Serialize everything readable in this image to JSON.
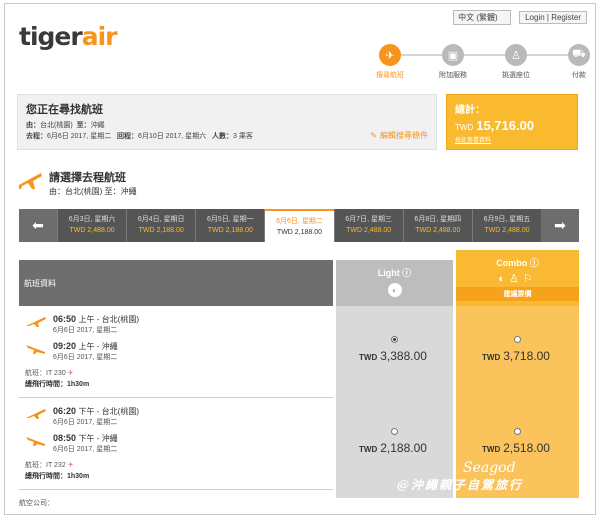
{
  "header": {
    "logo_prefix": "tiger",
    "logo_suffix": "air",
    "language": "中文 (繁體)",
    "login": "Login | Register"
  },
  "steps": [
    {
      "label": "搜尋航班",
      "icon": "plane-icon"
    },
    {
      "label": "附加服務",
      "icon": "bag-icon"
    },
    {
      "label": "挑選座位",
      "icon": "seat-icon"
    },
    {
      "label": "付款",
      "icon": "cart-icon"
    }
  ],
  "search": {
    "title": "您正在尋找航班",
    "from_label": "由：",
    "from": "台北(桃園)",
    "to_label": "至：",
    "to": "沖繩",
    "depart_label": "去程：",
    "depart": "6月6日 2017, 星期二",
    "return_label": "回程：",
    "return": "6月10日 2017, 星期六",
    "pax_label": "人數：",
    "pax": "3 乘客",
    "edit_link": "編輯搜尋條件"
  },
  "total": {
    "label": "總計：",
    "currency": "TWD",
    "amount": "15,716.00",
    "detail_link": "按此查看資料"
  },
  "outbound": {
    "title": "請選擇去程航班",
    "route": "由：台北(桃園) 至：沖繩"
  },
  "dates": [
    {
      "label": "6月3日, 星期六",
      "price": "TWD 2,488.00"
    },
    {
      "label": "6月4日, 星期日",
      "price": "TWD 2,188.00"
    },
    {
      "label": "6月5日, 星期一",
      "price": "TWD 2,188.00"
    },
    {
      "label": "6月6日, 星期二",
      "price": "TWD 2,188.00"
    },
    {
      "label": "6月7日, 星期三",
      "price": "TWD 2,488.00"
    },
    {
      "label": "6月8日, 星期四",
      "price": "TWD 2,488.00"
    },
    {
      "label": "6月9日, 星期五",
      "price": "TWD 2,488.00"
    }
  ],
  "fare_table": {
    "flight_header": "航班資料",
    "light_label": "Light",
    "combo_label": "Combo",
    "combo_tag": "建議票價"
  },
  "flights": [
    {
      "dep_time": "06:50",
      "dep_ampm": "上午 - 台北(桃園)",
      "dep_date": "6月6日 2017, 星期二",
      "arr_time": "09:20",
      "arr_ampm": "上午 - 沖繩",
      "arr_date": "6月6日 2017, 星期二",
      "flight_label": "航班：",
      "flight_no": "IT 230",
      "duration_label": "總飛行時間：",
      "duration": "1h30m",
      "light_price": "3,388.00",
      "combo_price": "3,718.00",
      "currency": "TWD"
    },
    {
      "dep_time": "06:20",
      "dep_ampm": "下午 - 台北(桃園)",
      "dep_date": "6月6日 2017, 星期二",
      "arr_time": "08:50",
      "arr_ampm": "下午 - 沖繩",
      "arr_date": "6月6日 2017, 星期二",
      "flight_label": "航班：",
      "flight_no": "IT 232",
      "duration_label": "總飛行時間：",
      "duration": "1h30m",
      "light_price": "2,188.00",
      "combo_price": "2,518.00",
      "currency": "TWD"
    }
  ],
  "footer": {
    "airline_label": "航空公司："
  },
  "watermark": {
    "line1": "Seagod",
    "line2": "@沖繩親子自駕旅行"
  },
  "colors": {
    "accent": "#f7941d",
    "total_bg": "#f9ba2f",
    "combo_bg": "#fbc35c"
  }
}
